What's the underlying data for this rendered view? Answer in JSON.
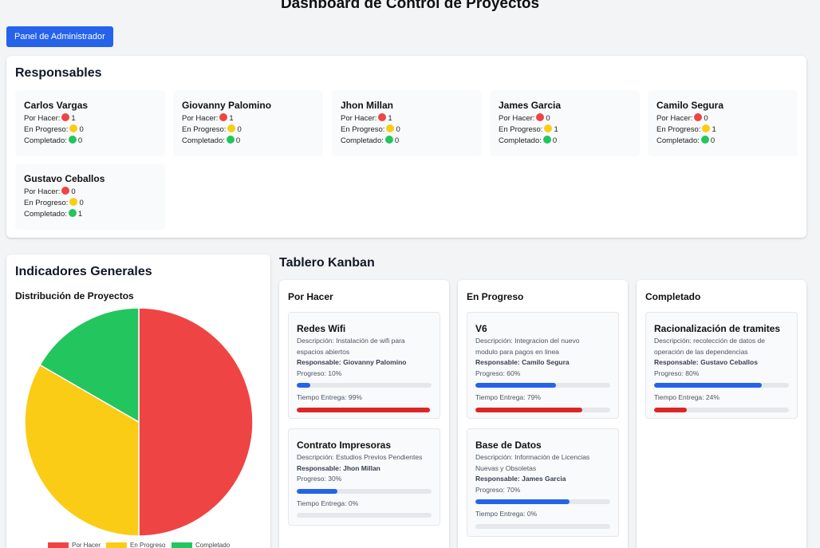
{
  "page": {
    "title": "Dashboard de Control de Proyectos"
  },
  "header": {
    "admin_button": "Panel de Administrador"
  },
  "colors": {
    "accent": "#2563eb",
    "por_hacer": "#ef4444",
    "en_progreso": "#facc15",
    "completado": "#22c55e",
    "delivery_bar": "#dc2626"
  },
  "labels": {
    "por_hacer": "Por Hacer:",
    "en_progreso": "En Progreso:",
    "completado": "Completado:",
    "descripcion": "Descripción:",
    "responsable": "Responsable:",
    "progreso": "Progreso:",
    "tiempo_entrega": "Tiempo Entrega:"
  },
  "responsables": {
    "title": "Responsables",
    "people": [
      {
        "name": "Carlos Vargas",
        "por_hacer": "1",
        "en_progreso": "0",
        "completado": "0"
      },
      {
        "name": "Giovanny Palomino",
        "por_hacer": "1",
        "en_progreso": "0",
        "completado": "0"
      },
      {
        "name": "Jhon Millan",
        "por_hacer": "1",
        "en_progreso": "0",
        "completado": "0"
      },
      {
        "name": "James Garcia",
        "por_hacer": "0",
        "en_progreso": "1",
        "completado": "0"
      },
      {
        "name": "Camilo Segura",
        "por_hacer": "0",
        "en_progreso": "1",
        "completado": "0"
      },
      {
        "name": "Gustavo Ceballos",
        "por_hacer": "0",
        "en_progreso": "0",
        "completado": "1"
      }
    ]
  },
  "indicadores": {
    "title": "Indicadores Generales",
    "chart_title": "Distribución de Proyectos"
  },
  "chart_data": {
    "type": "pie",
    "title": "Distribución de Proyectos",
    "categories": [
      "Por Hacer",
      "En Progreso",
      "Completado"
    ],
    "values": [
      3,
      2,
      1
    ],
    "colors": [
      "#ef4444",
      "#facc15",
      "#22c55e"
    ],
    "legend": "bottom"
  },
  "kanban": {
    "title": "Tablero Kanban",
    "columns": [
      {
        "title": "Por Hacer",
        "tasks": [
          {
            "title": "Redes Wifi",
            "description_l1": "Instalación de wifi para",
            "description_l2": "espacios abiertos",
            "responsable": "Giovanny Palomino",
            "progreso": "10%",
            "progreso_value": 10,
            "entrega": "99%",
            "entrega_value": 99
          },
          {
            "title": "Contrato Impresoras",
            "description_l1": "Estudios Previos Pendientes",
            "description_l2": "",
            "responsable": "Jhon Millan",
            "progreso": "30%",
            "progreso_value": 30,
            "entrega": "0%",
            "entrega_value": 0
          }
        ]
      },
      {
        "title": "En Progreso",
        "tasks": [
          {
            "title": "V6",
            "description_l1": "Integracion del nuevo",
            "description_l2": "modulo para pagos en linea",
            "responsable": "Camilo Segura",
            "progreso": "60%",
            "progreso_value": 60,
            "entrega": "79%",
            "entrega_value": 79
          },
          {
            "title": "Base de Datos",
            "description_l1": "Información de Licencias",
            "description_l2": "Nuevas y Obsoletas",
            "responsable": "James Garcia",
            "progreso": "70%",
            "progreso_value": 70,
            "entrega": "0%",
            "entrega_value": 0
          }
        ]
      },
      {
        "title": "Completado",
        "tasks": [
          {
            "title": "Racionalización de tramites",
            "description_l1": "recolección de datos de",
            "description_l2": "operación de las dependencias",
            "responsable": "Gustavo Ceballos",
            "progreso": "80%",
            "progreso_value": 80,
            "entrega": "24%",
            "entrega_value": 24
          }
        ]
      }
    ]
  }
}
